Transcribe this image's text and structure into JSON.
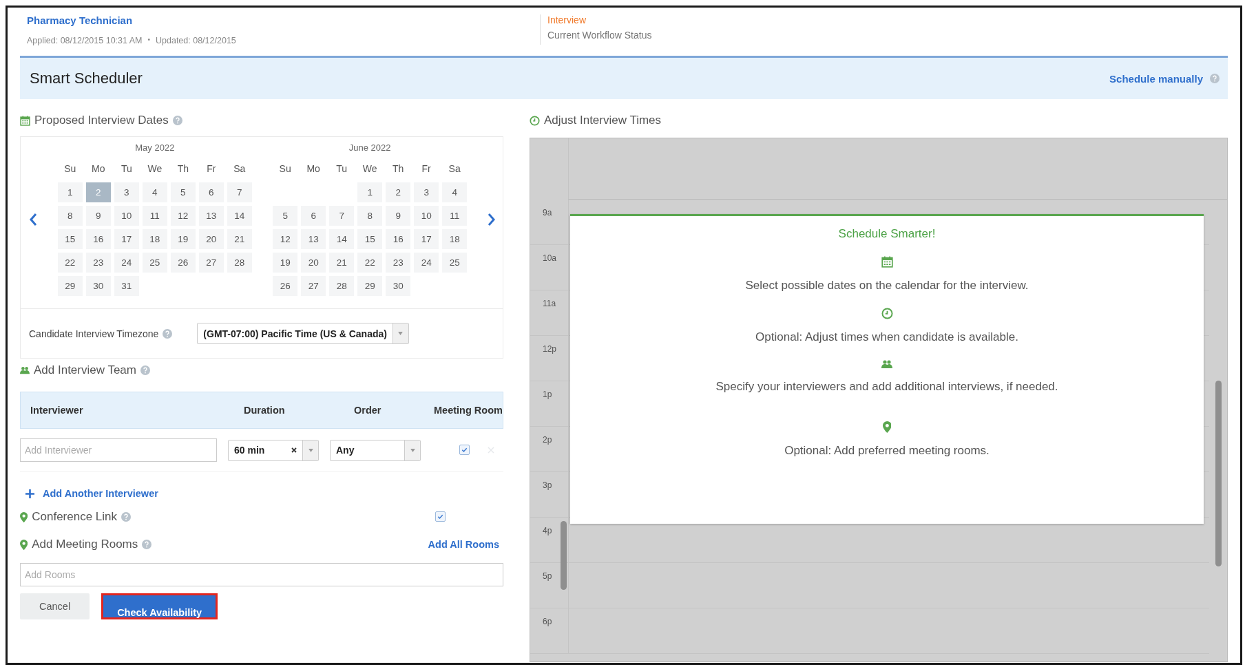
{
  "header": {
    "job_title": "Pharmacy Technician",
    "applied": "Applied: 08/12/2015 10:31 AM",
    "separator": "•",
    "updated": "Updated: 08/12/2015",
    "status": "Interview",
    "status_caption": "Current Workflow Status"
  },
  "scheduler": {
    "title": "Smart Scheduler",
    "manual_link": "Schedule manually"
  },
  "dates_section": {
    "title": "Proposed Interview Dates",
    "months": [
      {
        "title": "May 2022",
        "weekdays": [
          "Su",
          "Mo",
          "Tu",
          "We",
          "Th",
          "Fr",
          "Sa"
        ],
        "weeks": [
          [
            {
              "day": "1",
              "selected": false
            },
            {
              "day": "2",
              "selected": true
            },
            {
              "day": "3",
              "selected": false
            },
            {
              "day": "4",
              "selected": false
            },
            {
              "day": "5",
              "selected": false
            },
            {
              "day": "6",
              "selected": false
            },
            {
              "day": "7",
              "selected": false
            }
          ],
          [
            {
              "day": "8",
              "selected": false
            },
            {
              "day": "9",
              "selected": false
            },
            {
              "day": "10",
              "selected": false
            },
            {
              "day": "11",
              "selected": false
            },
            {
              "day": "12",
              "selected": false
            },
            {
              "day": "13",
              "selected": false
            },
            {
              "day": "14",
              "selected": false
            }
          ],
          [
            {
              "day": "15",
              "selected": false
            },
            {
              "day": "16",
              "selected": false
            },
            {
              "day": "17",
              "selected": false
            },
            {
              "day": "18",
              "selected": false
            },
            {
              "day": "19",
              "selected": false
            },
            {
              "day": "20",
              "selected": false
            },
            {
              "day": "21",
              "selected": false
            }
          ],
          [
            {
              "day": "22",
              "selected": false
            },
            {
              "day": "23",
              "selected": false
            },
            {
              "day": "24",
              "selected": false
            },
            {
              "day": "25",
              "selected": false
            },
            {
              "day": "26",
              "selected": false
            },
            {
              "day": "27",
              "selected": false
            },
            {
              "day": "28",
              "selected": false
            }
          ],
          [
            {
              "day": "29",
              "selected": false
            },
            {
              "day": "30",
              "selected": false
            },
            {
              "day": "31",
              "selected": false
            }
          ]
        ]
      },
      {
        "title": "June 2022",
        "weekdays": [
          "Su",
          "Mo",
          "Tu",
          "We",
          "Th",
          "Fr",
          "Sa"
        ],
        "weeks": [
          [
            {
              "day": "1",
              "selected": false
            },
            {
              "day": "2",
              "selected": false
            },
            {
              "day": "3",
              "selected": false
            },
            {
              "day": "4",
              "selected": false
            }
          ],
          [
            {
              "day": "5",
              "selected": false
            },
            {
              "day": "6",
              "selected": false
            },
            {
              "day": "7",
              "selected": false
            },
            {
              "day": "8",
              "selected": false
            },
            {
              "day": "9",
              "selected": false
            },
            {
              "day": "10",
              "selected": false
            },
            {
              "day": "11",
              "selected": false
            }
          ],
          [
            {
              "day": "12",
              "selected": false
            },
            {
              "day": "13",
              "selected": false
            },
            {
              "day": "14",
              "selected": false
            },
            {
              "day": "15",
              "selected": false
            },
            {
              "day": "16",
              "selected": false
            },
            {
              "day": "17",
              "selected": false
            },
            {
              "day": "18",
              "selected": false
            }
          ],
          [
            {
              "day": "19",
              "selected": false
            },
            {
              "day": "20",
              "selected": false
            },
            {
              "day": "21",
              "selected": false
            },
            {
              "day": "22",
              "selected": false
            },
            {
              "day": "23",
              "selected": false
            },
            {
              "day": "24",
              "selected": false
            },
            {
              "day": "25",
              "selected": false
            }
          ],
          [
            {
              "day": "26",
              "selected": false
            },
            {
              "day": "27",
              "selected": false
            },
            {
              "day": "28",
              "selected": false
            },
            {
              "day": "29",
              "selected": false
            },
            {
              "day": "30",
              "selected": false
            }
          ]
        ]
      }
    ],
    "timezone_label": "Candidate Interview Timezone",
    "timezone_value": "(GMT-07:00) Pacific Time (US & Canada)"
  },
  "team_section": {
    "title": "Add Interview Team",
    "columns": [
      "Interviewer",
      "Duration",
      "Order",
      "Meeting Room"
    ],
    "rows": [
      {
        "interviewer_placeholder": "Add Interviewer",
        "duration": "60 min",
        "order": "Any",
        "meeting_room_checked": true
      }
    ],
    "add_link": "Add Another Interviewer"
  },
  "conference": {
    "label": "Conference Link",
    "checked": true
  },
  "rooms": {
    "label": "Add Meeting Rooms",
    "add_all": "Add All Rooms",
    "placeholder": "Add Rooms"
  },
  "buttons": [
    {
      "label": "Cancel",
      "kind": "secondary",
      "highlighted": false
    },
    {
      "label": "Check Availability",
      "kind": "primary",
      "highlighted": true
    }
  ],
  "times_section": {
    "title": "Adjust Interview Times",
    "hours": [
      "9a",
      "10a",
      "11a",
      "12p",
      "1p",
      "2p",
      "3p",
      "4p",
      "5p",
      "6p"
    ],
    "overlay": {
      "title": "Schedule Smarter!",
      "steps": [
        {
          "kind": "calendar",
          "text": "Select possible dates on the calendar for the interview."
        },
        {
          "kind": "clock",
          "text": "Optional: Adjust times when candidate is available."
        },
        {
          "kind": "people",
          "text": "Specify your interviewers and add additional interviews, if needed."
        },
        {
          "kind": "pin",
          "text": "Optional: Add preferred meeting rooms."
        }
      ]
    }
  }
}
